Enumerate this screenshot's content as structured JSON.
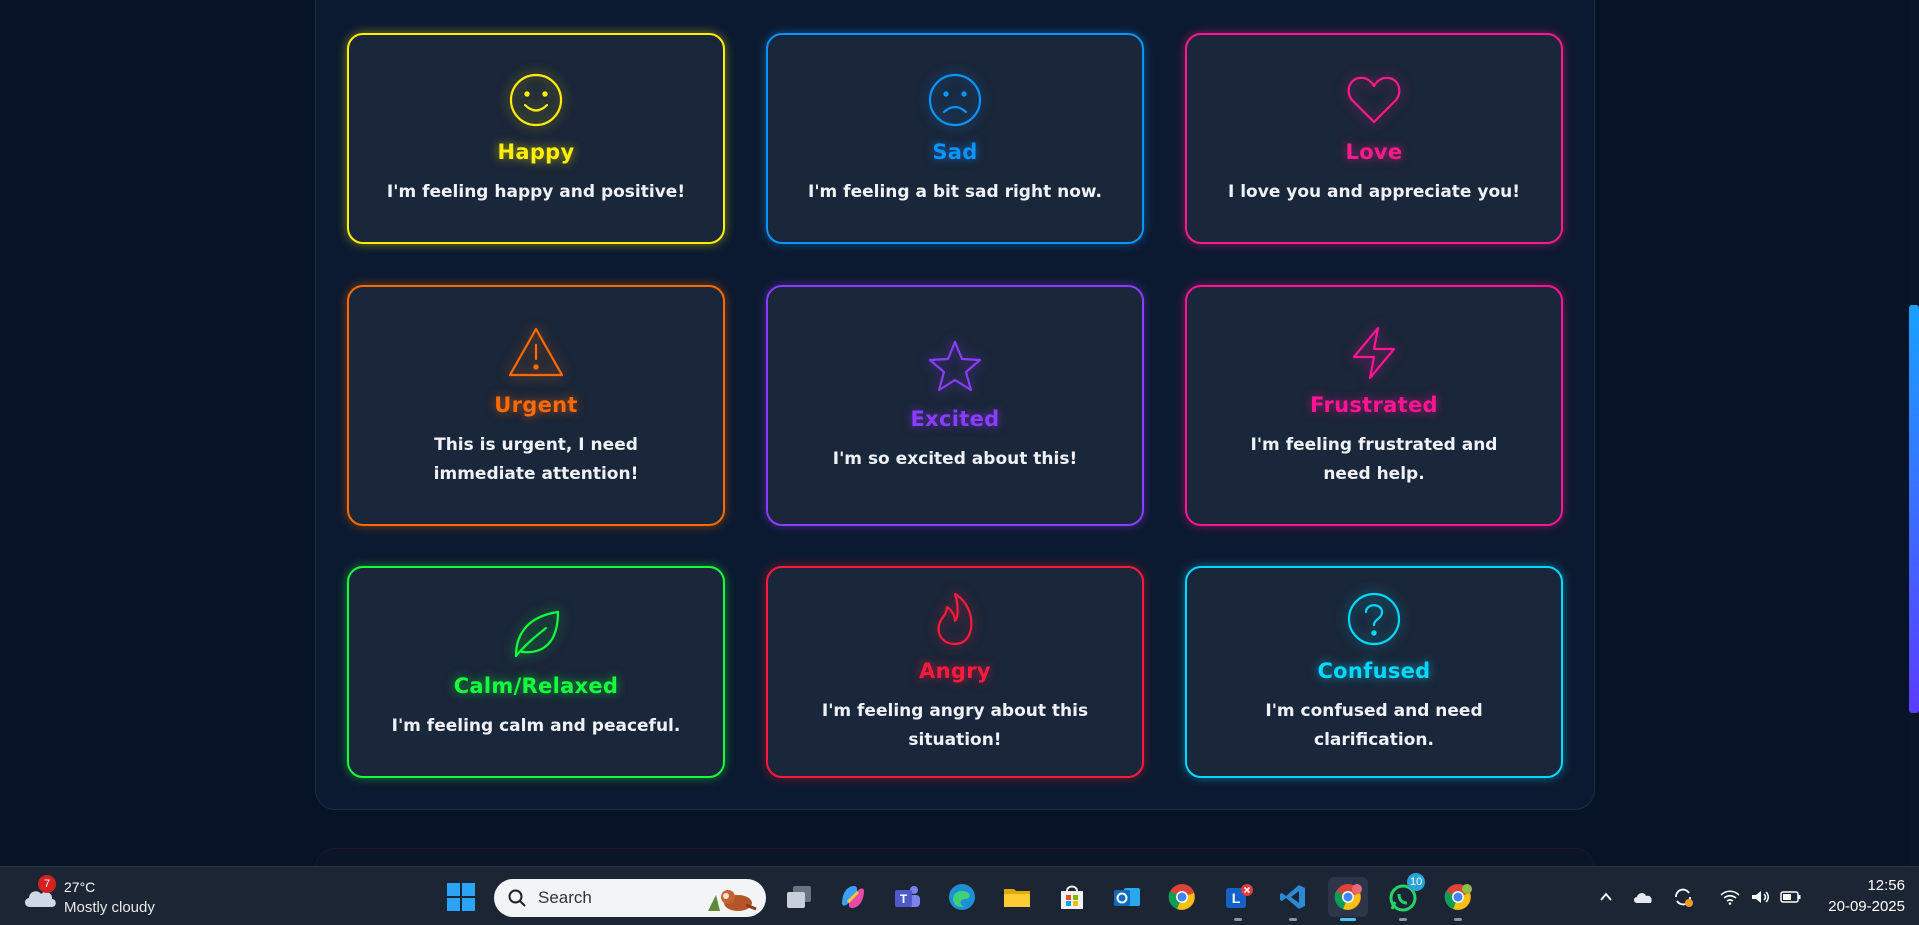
{
  "emotions": {
    "happy": {
      "title": "Happy",
      "message": "I'm feeling happy and positive!",
      "color": "#ffee00",
      "icon": "smile-icon"
    },
    "sad": {
      "title": "Sad",
      "message": "I'm feeling a bit sad right now.",
      "color": "#0a94ff",
      "icon": "frown-icon"
    },
    "love": {
      "title": "Love",
      "message": "I love you and appreciate you!",
      "color": "#ff1a8c",
      "icon": "heart-icon"
    },
    "urgent": {
      "title": "Urgent",
      "message": "This is urgent, I need immediate attention!",
      "color": "#ff6a00",
      "icon": "warning-icon"
    },
    "excited": {
      "title": "Excited",
      "message": "I'm so excited about this!",
      "color": "#8c3cff",
      "icon": "star-icon"
    },
    "frustrated": {
      "title": "Frustrated",
      "message": "I'm feeling frustrated and need help.",
      "color": "#ff1493",
      "icon": "lightning-icon"
    },
    "calm": {
      "title": "Calm/Relaxed",
      "message": "I'm feeling calm and peaceful.",
      "color": "#14ff3c",
      "icon": "leaf-icon"
    },
    "angry": {
      "title": "Angry",
      "message": "I'm feeling angry about this situation!",
      "color": "#ff1a3c",
      "icon": "flame-icon"
    },
    "confused": {
      "title": "Confused",
      "message": "I'm confused and need clarification.",
      "color": "#00d8ff",
      "icon": "question-icon"
    }
  },
  "taskbar": {
    "weather": {
      "badge": "7",
      "temperature": "27°C",
      "condition": "Mostly cloudy",
      "icon": "cloud-icon"
    },
    "search_placeholder": "Search",
    "apps": [
      "windows-start",
      "task-view",
      "copilot",
      "teams",
      "edge",
      "file-explorer",
      "microsoft-store",
      "outlook",
      "chrome",
      "lyncode",
      "vscode",
      "chrome-profile",
      "whatsapp",
      "chrome-profile-2"
    ],
    "whatsapp_badge": "10",
    "clock": {
      "time": "12:56",
      "date": "20-09-2025"
    }
  }
}
